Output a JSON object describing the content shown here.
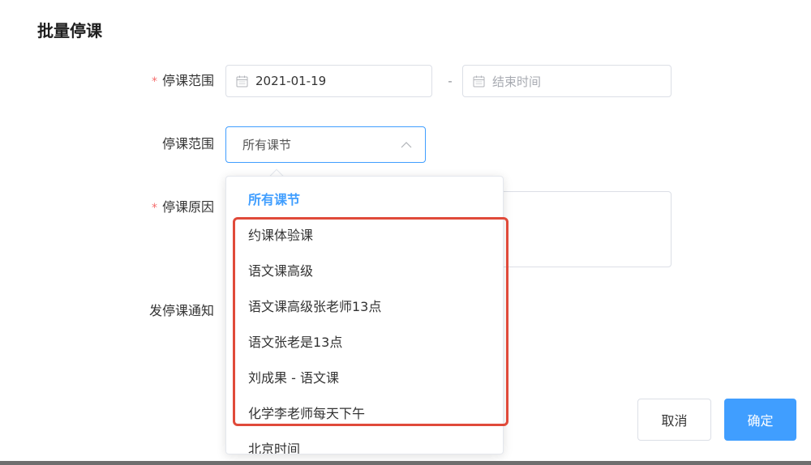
{
  "dialog": {
    "title": "批量停课"
  },
  "form": {
    "date_range": {
      "label": "停课范围",
      "required_mark": "*",
      "start_value": "2021-01-19",
      "separator": "-",
      "end_placeholder": "结束时间",
      "icon": "calendar-icon"
    },
    "scope": {
      "label": "停课范围",
      "selected": "所有课节",
      "icon": "chevron-up-icon"
    },
    "reason": {
      "label": "停课原因",
      "required_mark": "*"
    },
    "notify": {
      "label": "发停课通知"
    }
  },
  "dropdown": {
    "options": [
      {
        "label": "所有课节",
        "selected": true
      },
      {
        "label": "约课体验课"
      },
      {
        "label": "语文课高级"
      },
      {
        "label": "语文课高级张老师13点"
      },
      {
        "label": "语文张老是13点"
      },
      {
        "label": "刘成果 - 语文课"
      },
      {
        "label": "化学李老师每天下午"
      },
      {
        "label": "北京时间"
      }
    ]
  },
  "buttons": {
    "cancel": "取消",
    "confirm": "确定"
  },
  "colors": {
    "primary": "#409eff",
    "required": "#f56c6c",
    "annotation": "#e04a3a"
  }
}
